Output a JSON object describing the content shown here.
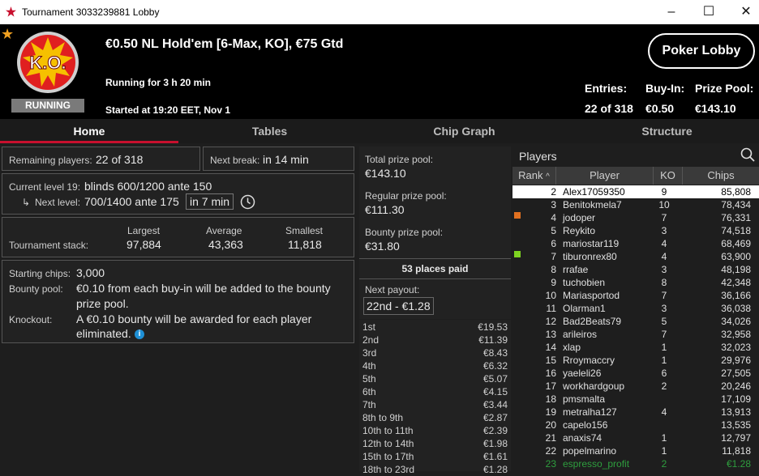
{
  "window": {
    "title": "Tournament 3033239881 Lobby",
    "minimize": "–",
    "maximize": "☐",
    "close": "✕"
  },
  "header": {
    "badge": "RUNNING",
    "logo_text": "K.O.",
    "title": "€0.50 NL Hold'em [6-Max, KO], €75 Gtd",
    "running_for": "Running for 3 h 20 min",
    "started": "Started at 19:20 EET, Nov 1",
    "lobby_button": "Poker Lobby",
    "entries_label": "Entries:",
    "entries_value": "22 of 318",
    "buyin_label": "Buy-In:",
    "buyin_value": "€0.50",
    "prize_label": "Prize Pool:",
    "prize_value": "€143.10"
  },
  "tabs": [
    "Home",
    "Tables",
    "Chip Graph",
    "Structure"
  ],
  "home": {
    "remaining_label": "Remaining players:",
    "remaining_value": "22 of 318",
    "next_break_label": "Next break:",
    "next_break_value": "in 14 min",
    "current_level_label": "Current level 19:",
    "current_level_value": "blinds 600/1200 ante 150",
    "next_level_label": "Next level:",
    "next_level_value": "700/1400 ante 175",
    "next_level_time": "in 7 min",
    "stack_label": "Tournament stack:",
    "largest_label": "Largest",
    "largest_value": "97,884",
    "average_label": "Average",
    "average_value": "43,363",
    "smallest_label": "Smallest",
    "smallest_value": "11,818",
    "starting_chips_label": "Starting chips:",
    "starting_chips_value": "3,000",
    "bounty_pool_label": "Bounty pool:",
    "bounty_pool_line1": "€0.10 from each buy-in will be added to the bounty",
    "bounty_pool_line2": "prize pool.",
    "knockout_label": "Knockout:",
    "knockout_line1": "A €0.10 bounty will be awarded for each player",
    "knockout_line2": "eliminated.",
    "info_icon": "i"
  },
  "prizes": {
    "total_label": "Total prize pool:",
    "total_value": "€143.10",
    "regular_label": "Regular prize pool:",
    "regular_value": "€111.30",
    "bounty_label": "Bounty prize pool:",
    "bounty_value": "€31.80",
    "places_paid": "53 places paid",
    "next_payout_label": "Next payout:",
    "next_payout_value": "22nd - €1.28",
    "payouts": [
      {
        "place": "1st",
        "amount": "€19.53"
      },
      {
        "place": "2nd",
        "amount": "€11.39"
      },
      {
        "place": "3rd",
        "amount": "€8.43"
      },
      {
        "place": "4th",
        "amount": "€6.32"
      },
      {
        "place": "5th",
        "amount": "€5.07"
      },
      {
        "place": "6th",
        "amount": "€4.15"
      },
      {
        "place": "7th",
        "amount": "€3.44"
      },
      {
        "place": "8th to 9th",
        "amount": "€2.87"
      },
      {
        "place": "10th to 11th",
        "amount": "€2.39"
      },
      {
        "place": "12th to 14th",
        "amount": "€1.98"
      },
      {
        "place": "15th to 17th",
        "amount": "€1.61"
      },
      {
        "place": "18th to 23rd",
        "amount": "€1.28"
      }
    ]
  },
  "players": {
    "title": "Players",
    "columns": {
      "rank": "Rank",
      "player": "Player",
      "ko": "KO",
      "chips": "Chips"
    },
    "rows": [
      {
        "rank": "2",
        "player": "Alex17059350",
        "ko": "9",
        "chips": "85,808",
        "selected": true
      },
      {
        "rank": "3",
        "player": "Benitokmela7",
        "ko": "10",
        "chips": "78,434"
      },
      {
        "rank": "4",
        "player": "jodoper",
        "ko": "7",
        "chips": "76,331",
        "marker": "#e07020"
      },
      {
        "rank": "5",
        "player": "Reykito",
        "ko": "3",
        "chips": "74,518"
      },
      {
        "rank": "6",
        "player": "mariostar119",
        "ko": "4",
        "chips": "68,469"
      },
      {
        "rank": "7",
        "player": "tiburonrex80",
        "ko": "4",
        "chips": "63,900",
        "marker": "#7ed321"
      },
      {
        "rank": "8",
        "player": "rrafae",
        "ko": "3",
        "chips": "48,198"
      },
      {
        "rank": "9",
        "player": "tuchobien",
        "ko": "8",
        "chips": "42,348"
      },
      {
        "rank": "10",
        "player": "Mariasportod",
        "ko": "7",
        "chips": "36,166"
      },
      {
        "rank": "11",
        "player": "Olarman1",
        "ko": "3",
        "chips": "36,038"
      },
      {
        "rank": "12",
        "player": "Bad2Beats79",
        "ko": "5",
        "chips": "34,026"
      },
      {
        "rank": "13",
        "player": "arileiros",
        "ko": "7",
        "chips": "32,958"
      },
      {
        "rank": "14",
        "player": "xlap",
        "ko": "1",
        "chips": "32,023"
      },
      {
        "rank": "15",
        "player": "Rroymaccry",
        "ko": "1",
        "chips": "29,976"
      },
      {
        "rank": "16",
        "player": "yaeleli26",
        "ko": "6",
        "chips": "27,505"
      },
      {
        "rank": "17",
        "player": "workhardgoup",
        "ko": "2",
        "chips": "20,246"
      },
      {
        "rank": "18",
        "player": "pmsmalta",
        "ko": "",
        "chips": "17,109"
      },
      {
        "rank": "19",
        "player": "metralha127",
        "ko": "4",
        "chips": "13,913"
      },
      {
        "rank": "20",
        "player": "capelo156",
        "ko": "",
        "chips": "13,535"
      },
      {
        "rank": "21",
        "player": "anaxis74",
        "ko": "1",
        "chips": "12,797"
      },
      {
        "rank": "22",
        "player": "popelmarino",
        "ko": "1",
        "chips": "11,818"
      },
      {
        "rank": "23",
        "player": "espresso_profit",
        "ko": "2",
        "chips": "€1.28",
        "eliminated": true
      }
    ]
  }
}
